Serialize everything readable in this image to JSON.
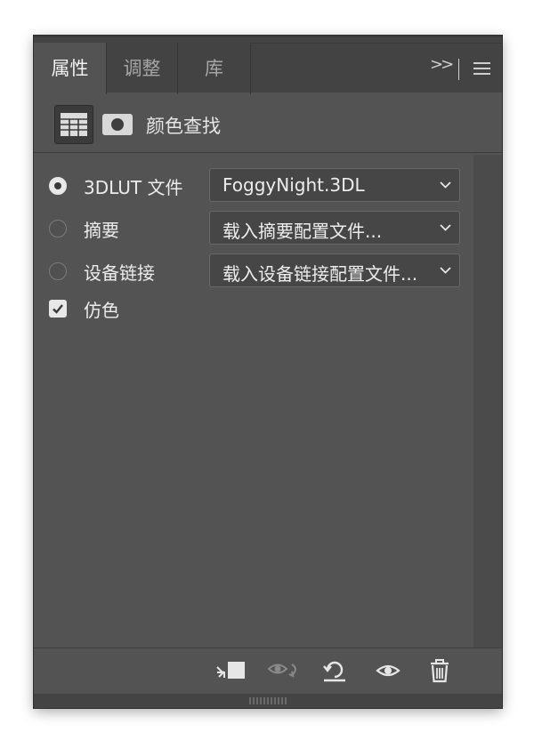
{
  "tabs": [
    {
      "label": "属性",
      "active": true
    },
    {
      "label": "调整",
      "active": false
    },
    {
      "label": "库",
      "active": false
    }
  ],
  "panel_controls": {
    "collapse_icon": "double-chevron-right-icon",
    "menu_icon": "hamburger-menu-icon"
  },
  "header": {
    "title": "颜色查找",
    "adjustment_icon": "grid-table-icon",
    "mask_icon": "layer-mask-icon"
  },
  "options": [
    {
      "type": "radio",
      "label": "3DLUT 文件",
      "checked": true,
      "select_value": "FoggyNight.3DL"
    },
    {
      "type": "radio",
      "label": "摘要",
      "checked": false,
      "select_value": "载入摘要配置文件..."
    },
    {
      "type": "radio",
      "label": "设备链接",
      "checked": false,
      "select_value": "载入设备链接配置文件..."
    },
    {
      "type": "checkbox",
      "label": "仿色",
      "checked": true
    }
  ],
  "toolbar": {
    "icons": [
      "clip-to-layer-icon",
      "view-previous-state-icon",
      "reset-icon",
      "visibility-eye-icon",
      "trash-icon"
    ]
  },
  "colors": {
    "panel_bg": "#535353",
    "tabbar_bg": "#434343",
    "text": "#e6e6e6"
  }
}
